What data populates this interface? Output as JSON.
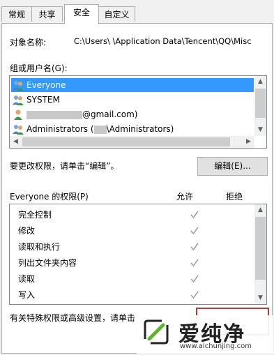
{
  "tabs": [
    {
      "label": "常规"
    },
    {
      "label": "共享"
    },
    {
      "label": "安全"
    },
    {
      "label": "自定义"
    }
  ],
  "object_name": {
    "label": "对象名称:",
    "value": "C:\\Users\\   \\Application Data\\Tencent\\QQ\\Misc"
  },
  "group_label": "组或用户名(G):",
  "users": [
    {
      "name": "Everyone",
      "icon": "group-users-icon",
      "selected": true
    },
    {
      "name": "SYSTEM",
      "icon": "group-users-icon",
      "selected": false
    },
    {
      "name": "@gmail.com)",
      "icon": "user-icon",
      "selected": false
    },
    {
      "name_prefix": "Administrators (",
      "name_suffix": "\\Administrators)",
      "icon": "group-users-icon",
      "selected": false
    }
  ],
  "edit_hint": "要更改权限，请单击“编辑”。",
  "edit_button": "编辑(E)...",
  "permissions": {
    "title": "Everyone 的权限(P)",
    "allow_header": "允许",
    "deny_header": "拒绝",
    "rows": [
      {
        "name": "完全控制",
        "allow": true,
        "deny": false
      },
      {
        "name": "修改",
        "allow": true,
        "deny": false
      },
      {
        "name": "读取和执行",
        "allow": true,
        "deny": false
      },
      {
        "name": "列出文件夹内容",
        "allow": true,
        "deny": false
      },
      {
        "name": "读取",
        "allow": true,
        "deny": false
      },
      {
        "name": "写入",
        "allow": true,
        "deny": false
      }
    ]
  },
  "advanced_hint": "有关特殊权限或高级设置，请单击",
  "watermark": {
    "brand": "爱纯净",
    "url": "www.aichunjing.com"
  },
  "colors": {
    "selection": "#3399ff",
    "highlight_border": "#b33a3a",
    "checkmark": "#a0a0a0"
  }
}
